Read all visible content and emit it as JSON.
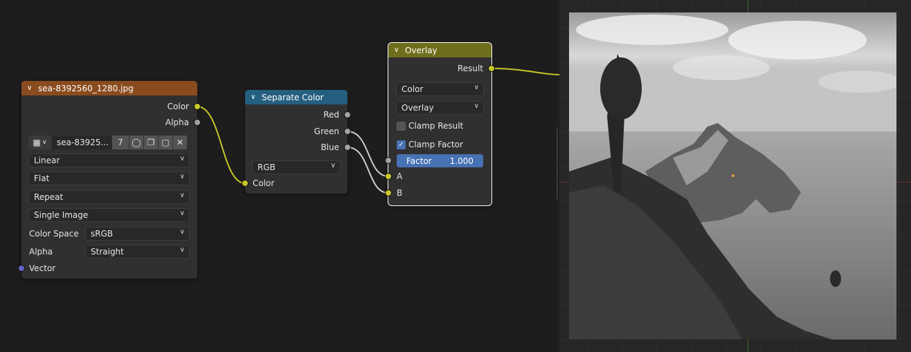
{
  "image_node": {
    "title": "sea-8392560_1280.jpg",
    "outputs": [
      "Color",
      "Alpha"
    ],
    "image_name": "sea-83925...",
    "user_count": "7",
    "interpolation": "Linear",
    "projection": "Flat",
    "extension": "Repeat",
    "source": "Single Image",
    "color_space_label": "Color Space",
    "color_space_value": "sRGB",
    "alpha_label": "Alpha",
    "alpha_value": "Straight",
    "input_vector": "Vector",
    "header_color": "#8a4c1f"
  },
  "separate_node": {
    "title": "Separate Color",
    "outputs": [
      "Red",
      "Green",
      "Blue"
    ],
    "mode": "RGB",
    "input_color": "Color",
    "header_color": "#245f80"
  },
  "overlay_node": {
    "title": "Overlay",
    "output": "Result",
    "data_type": "Color",
    "blend_mode": "Overlay",
    "clamp_result_label": "Clamp Result",
    "clamp_result_checked": false,
    "clamp_factor_label": "Clamp Factor",
    "clamp_factor_checked": true,
    "factor_label": "Factor",
    "factor_value": "1.000",
    "input_a": "A",
    "input_b": "B",
    "header_color": "#6e6d1b"
  },
  "colors": {
    "accent": "#4772b3",
    "socket_color": "#c7c729",
    "socket_float": "#a1a1a1",
    "socket_vector": "#6363c7"
  }
}
